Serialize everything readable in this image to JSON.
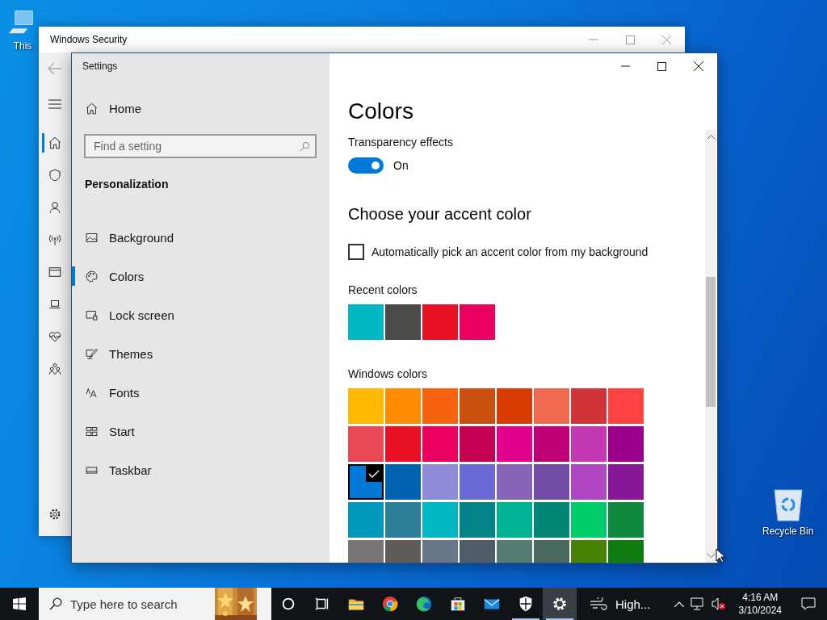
{
  "desktop": {
    "icons": [
      {
        "kind": "computer",
        "label": "This"
      },
      {
        "kind": "recycle-bin",
        "label": "Recycle Bin"
      }
    ]
  },
  "security_window": {
    "title": "Windows Security",
    "rail": [
      {
        "kind": "home",
        "selected": true
      },
      {
        "kind": "shield",
        "selected": false
      },
      {
        "kind": "person",
        "selected": false
      },
      {
        "kind": "antenna",
        "selected": false
      },
      {
        "kind": "window",
        "selected": false
      },
      {
        "kind": "laptop",
        "selected": false
      },
      {
        "kind": "heart",
        "selected": false
      },
      {
        "kind": "people",
        "selected": false
      }
    ]
  },
  "settings_window": {
    "title": "Settings",
    "home": "Home",
    "search_placeholder": "Find a setting",
    "section": "Personalization",
    "nav": [
      {
        "kind": "background",
        "label": "Background",
        "selected": false
      },
      {
        "kind": "colors",
        "label": "Colors",
        "selected": true
      },
      {
        "kind": "lock-screen",
        "label": "Lock screen",
        "selected": false
      },
      {
        "kind": "themes",
        "label": "Themes",
        "selected": false
      },
      {
        "kind": "fonts",
        "label": "Fonts",
        "selected": false
      },
      {
        "kind": "start",
        "label": "Start",
        "selected": false
      },
      {
        "kind": "taskbar",
        "label": "Taskbar",
        "selected": false
      }
    ],
    "page": {
      "heading": "Colors",
      "transparency": {
        "label": "Transparency effects",
        "on": true,
        "state": "On"
      },
      "accent_heading": "Choose your accent color",
      "auto_pick": {
        "label": "Automatically pick an accent color from my background",
        "checked": false
      },
      "recent_colors": {
        "label": "Recent colors",
        "swatches": [
          {
            "color": "#00b7c3",
            "selected": false
          },
          {
            "color": "#4c4a48",
            "selected": false
          },
          {
            "color": "#e81123",
            "selected": false
          },
          {
            "color": "#ea005e",
            "selected": false
          }
        ]
      },
      "windows_colors": {
        "label": "Windows colors",
        "swatches": [
          {
            "color": "#ffb900",
            "selected": false
          },
          {
            "color": "#ff8c00",
            "selected": false
          },
          {
            "color": "#f7630c",
            "selected": false
          },
          {
            "color": "#ca5010",
            "selected": false
          },
          {
            "color": "#da3b01",
            "selected": false
          },
          {
            "color": "#ef6950",
            "selected": false
          },
          {
            "color": "#d13438",
            "selected": false
          },
          {
            "color": "#ff4343",
            "selected": false
          },
          {
            "color": "#e74856",
            "selected": false
          },
          {
            "color": "#e81123",
            "selected": false
          },
          {
            "color": "#ea005e",
            "selected": false
          },
          {
            "color": "#c30052",
            "selected": false
          },
          {
            "color": "#e3008c",
            "selected": false
          },
          {
            "color": "#bf0077",
            "selected": false
          },
          {
            "color": "#c239b3",
            "selected": false
          },
          {
            "color": "#9a0089",
            "selected": false
          },
          {
            "color": "#0078d7",
            "selected": true
          },
          {
            "color": "#0063b1",
            "selected": false
          },
          {
            "color": "#8e8cd8",
            "selected": false
          },
          {
            "color": "#6b69d6",
            "selected": false
          },
          {
            "color": "#8764b8",
            "selected": false
          },
          {
            "color": "#744da9",
            "selected": false
          },
          {
            "color": "#b146c2",
            "selected": false
          },
          {
            "color": "#881798",
            "selected": false
          },
          {
            "color": "#0099bc",
            "selected": false
          },
          {
            "color": "#2d7d9a",
            "selected": false
          },
          {
            "color": "#00b7c3",
            "selected": false
          },
          {
            "color": "#038387",
            "selected": false
          },
          {
            "color": "#00b294",
            "selected": false
          },
          {
            "color": "#018574",
            "selected": false
          },
          {
            "color": "#00cc6a",
            "selected": false
          },
          {
            "color": "#10893e",
            "selected": false
          },
          {
            "color": "#7a7574",
            "selected": false
          },
          {
            "color": "#5d5a58",
            "selected": false
          },
          {
            "color": "#68768a",
            "selected": false
          },
          {
            "color": "#515c6b",
            "selected": false
          },
          {
            "color": "#567c73",
            "selected": false
          },
          {
            "color": "#486860",
            "selected": false
          },
          {
            "color": "#498205",
            "selected": false
          },
          {
            "color": "#107c10",
            "selected": false
          }
        ]
      }
    }
  },
  "taskbar": {
    "search_placeholder": "Type here to search",
    "apps": [
      {
        "kind": "cortana",
        "running": false,
        "selected": false
      },
      {
        "kind": "task-view",
        "running": false,
        "selected": false
      },
      {
        "kind": "explorer",
        "running": false,
        "selected": false
      },
      {
        "kind": "chrome",
        "running": false,
        "selected": false
      },
      {
        "kind": "edge",
        "running": false,
        "selected": false
      },
      {
        "kind": "store",
        "running": false,
        "selected": false
      },
      {
        "kind": "mail",
        "running": false,
        "selected": false
      },
      {
        "kind": "security",
        "running": true,
        "selected": false
      },
      {
        "kind": "settings",
        "running": true,
        "selected": true
      }
    ],
    "weather": "High...",
    "time": "4:16 AM",
    "date": "3/10/2024"
  }
}
